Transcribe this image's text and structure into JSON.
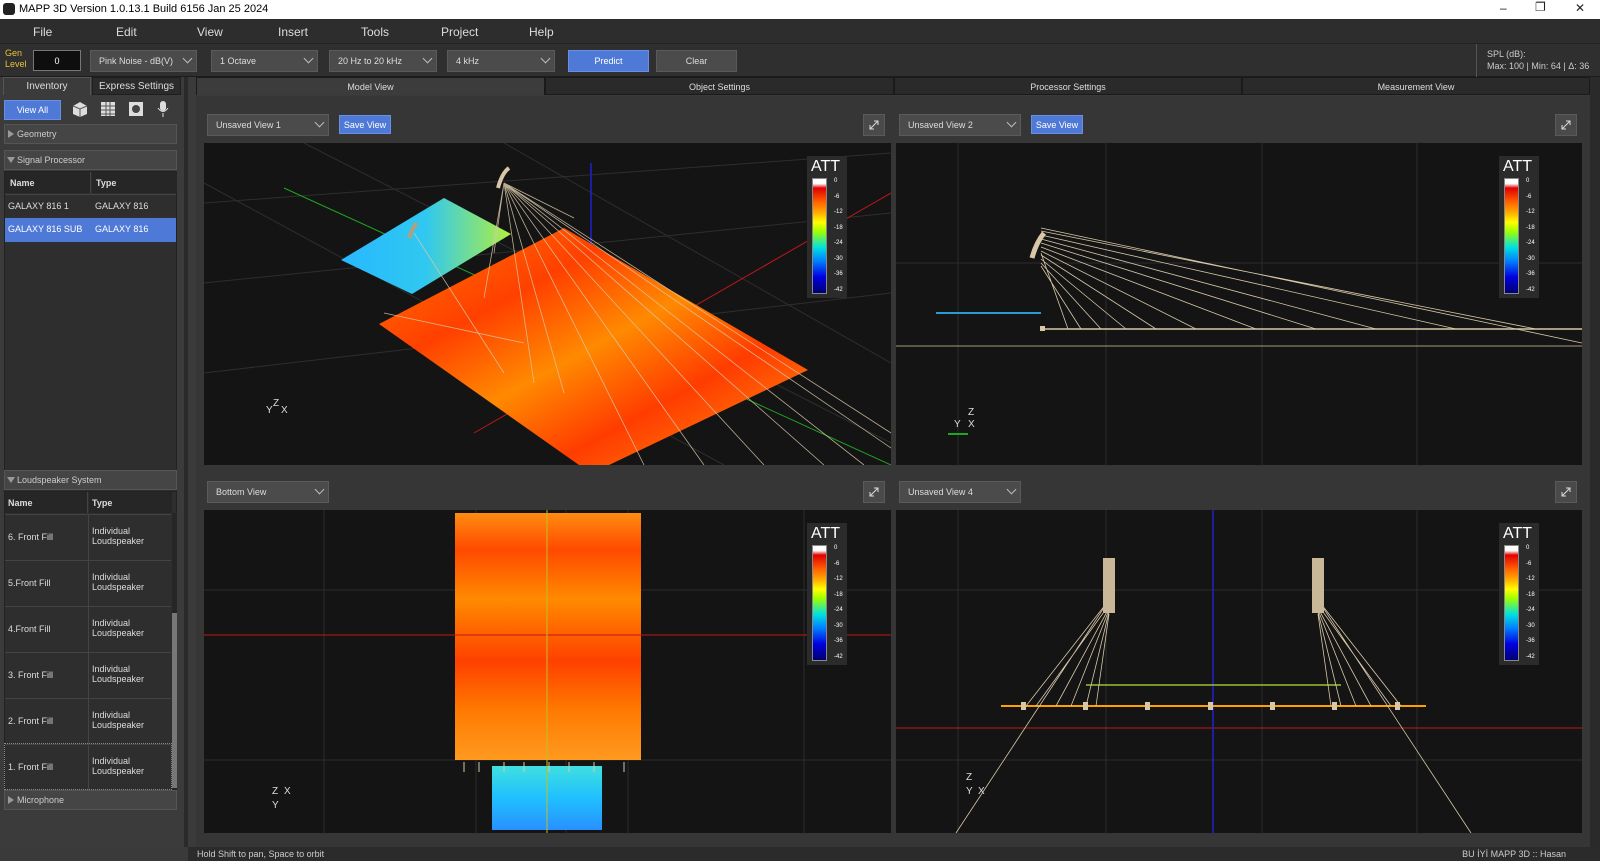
{
  "window": {
    "title": "MAPP 3D Version 1.0.13.1 Build 6156 Jan 25 2024"
  },
  "menu": [
    "File",
    "Edit",
    "View",
    "Insert",
    "Tools",
    "Project",
    "Help"
  ],
  "toolbar": {
    "gen_level_label": "Gen\nLevel",
    "gen_level_value": "0",
    "signal": "Pink Noise - dB(V)",
    "bandwidth": "1 Octave",
    "range": "20 Hz to 20 kHz",
    "frequency": "4 kHz",
    "predict": "Predict",
    "clear": "Clear",
    "spl_label": "SPL (dB):",
    "spl_stats": "Max: 100 | Min: 64 | Δ: 36"
  },
  "left": {
    "tabs": [
      "Inventory",
      "Express Settings"
    ],
    "view_all": "View All",
    "geometry": "Geometry",
    "signal_processor": {
      "title": "Signal Processor",
      "cols": [
        "Name",
        "Type"
      ],
      "rows": [
        {
          "name": "GALAXY 816 1",
          "type": "GALAXY 816",
          "selected": false
        },
        {
          "name": "GALAXY 816 SUB",
          "type": "GALAXY 816",
          "selected": true
        }
      ]
    },
    "loudspeaker_system": {
      "title": "Loudspeaker System",
      "cols": [
        "Name",
        "Type"
      ],
      "rows": [
        {
          "name": "6. Front Fill",
          "type": "Individual Loudspeaker"
        },
        {
          "name": "5.Front Fill",
          "type": "Individual Loudspeaker"
        },
        {
          "name": "4.Front Fill",
          "type": "Individual Loudspeaker"
        },
        {
          "name": "3. Front Fill",
          "type": "Individual Loudspeaker"
        },
        {
          "name": "2. Front Fill",
          "type": "Individual Loudspeaker"
        },
        {
          "name": "1. Front Fill",
          "type": "Individual Loudspeaker"
        }
      ]
    },
    "microphone": "Microphone"
  },
  "view_tabs": [
    "Model View",
    "Object Settings",
    "Processor Settings",
    "Measurement View"
  ],
  "viewports": [
    {
      "view": "Unsaved View 1",
      "save": "Save View"
    },
    {
      "view": "Unsaved View 2",
      "save": "Save View"
    },
    {
      "view": "Bottom View"
    },
    {
      "view": "Unsaved View 4"
    }
  ],
  "legend": {
    "title": "ATT",
    "labels": [
      "0",
      "-6",
      "-12",
      "-18",
      "-24",
      "-30",
      "-36",
      "-42"
    ]
  },
  "axis": {
    "x": "X",
    "y": "Y",
    "z": "Z"
  },
  "status": {
    "hint": "Hold Shift to pan, Space to orbit",
    "user": "BU İYİ MAPP 3D :: Hasan"
  },
  "colors": {
    "accent": "#4f79d6",
    "selected_row": "#4f79d6",
    "heat_hot": "#ff4a00",
    "heat_warm": "#ff8c00"
  }
}
